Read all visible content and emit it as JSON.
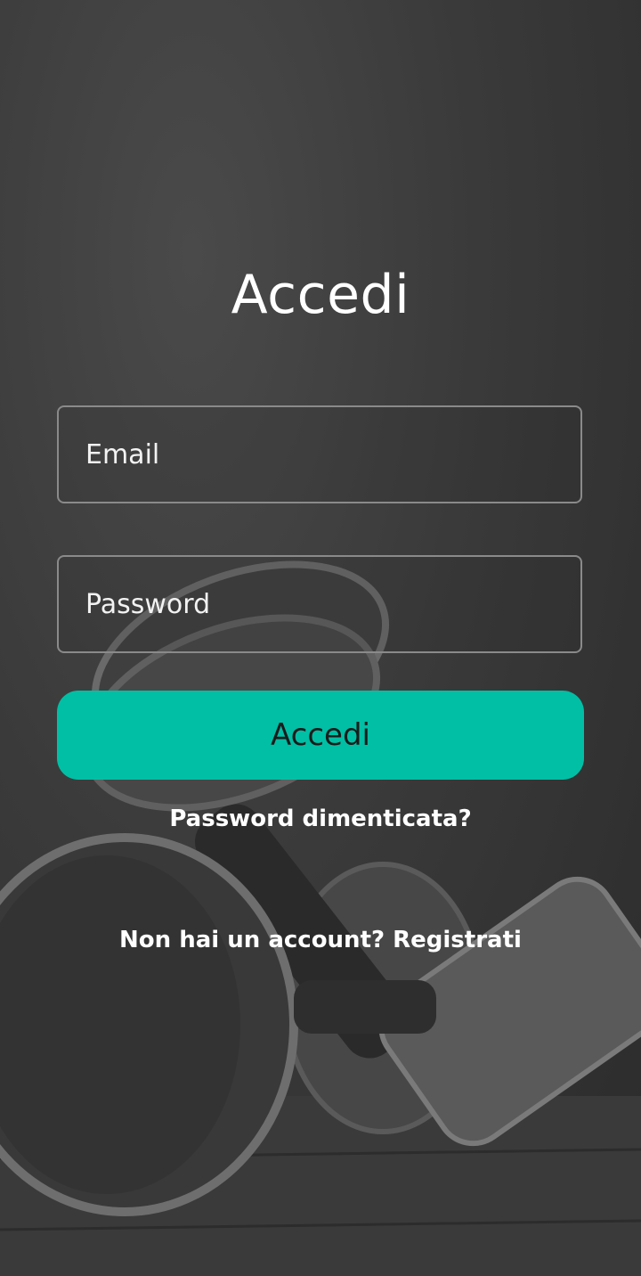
{
  "login": {
    "title": "Accedi",
    "email_placeholder": "Email",
    "password_placeholder": "Password",
    "submit_label": "Accedi",
    "forgot_password": "Password dimenticata?",
    "signup_prompt": "Non hai un account? Registrati"
  },
  "colors": {
    "accent": "#00bfa5",
    "field_border": "#8a8a8a",
    "text": "#ffffff"
  },
  "background": {
    "icon": "dumbbell-photo"
  }
}
